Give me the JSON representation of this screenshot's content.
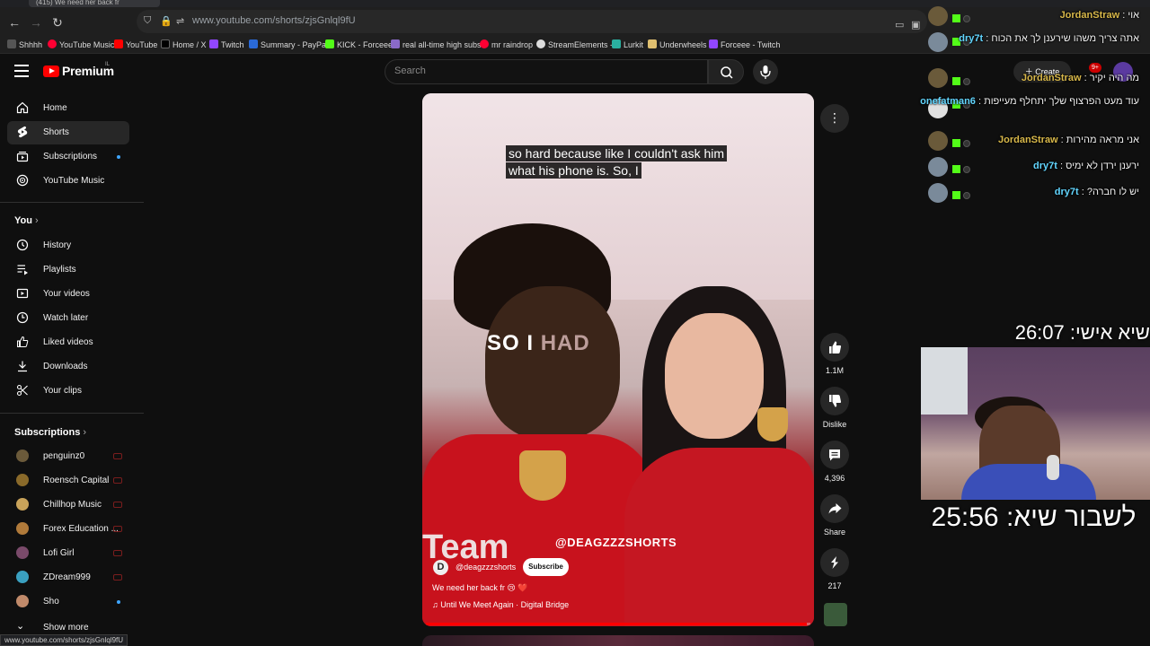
{
  "browser": {
    "active_tab": "(415) We need her back fr",
    "url": "www.youtube.com/shorts/zjsGnlql9fU",
    "bookmarks": [
      "Shhhh",
      "YouTube Music",
      "YouTube",
      "Home / X",
      "Twitch",
      "Summary - PayPal",
      "KICK - Forceee",
      "real all-time high subs",
      "mr raindrop",
      "StreamElements -",
      "Lurkit",
      "Underwheels",
      "Forceee - Twitch"
    ],
    "status_url": "www.youtube.com/shorts/zjsGnlql9fU"
  },
  "header": {
    "logo_text": "Premium",
    "region": "IL",
    "search_placeholder": "Search",
    "create_label": "Create",
    "notif_count": "9+"
  },
  "sidebar": {
    "main": [
      {
        "label": "Home",
        "icon": "home-icon"
      },
      {
        "label": "Shorts",
        "icon": "shorts-icon",
        "active": true
      },
      {
        "label": "Subscriptions",
        "icon": "subscriptions-icon",
        "dot": true
      },
      {
        "label": "YouTube Music",
        "icon": "music-icon"
      }
    ],
    "you_heading": "You",
    "you": [
      {
        "label": "History",
        "icon": "history-icon"
      },
      {
        "label": "Playlists",
        "icon": "playlists-icon"
      },
      {
        "label": "Your videos",
        "icon": "your-videos-icon"
      },
      {
        "label": "Watch later",
        "icon": "clock-icon"
      },
      {
        "label": "Liked videos",
        "icon": "thumbs-up-icon"
      },
      {
        "label": "Downloads",
        "icon": "download-icon"
      },
      {
        "label": "Your clips",
        "icon": "scissors-icon"
      }
    ],
    "subs_heading": "Subscriptions",
    "subscriptions": [
      {
        "label": "penguinz0",
        "live": true,
        "color": "#6b5a3a"
      },
      {
        "label": "Roensch Capital",
        "live": true,
        "color": "#8a6a2a"
      },
      {
        "label": "Chillhop Music",
        "live": true,
        "color": "#c9a35a"
      },
      {
        "label": "Forex Education ...",
        "live": true,
        "color": "#b07a3a"
      },
      {
        "label": "Lofi Girl",
        "live": true,
        "color": "#7a4a6a"
      },
      {
        "label": "ZDream999",
        "live": true,
        "color": "#3aa0c0"
      },
      {
        "label": "Sho",
        "dot": true,
        "color": "#c08a6a"
      }
    ],
    "show_more": "Show more"
  },
  "video": {
    "caption_lines": [
      "so hard because like I couldn't ask him",
      "what his phone is. So, I"
    ],
    "big_caption_bright": "SO I",
    "big_caption_dim": "HAD",
    "jersey_text": "Team",
    "watermark": "@DEAGZZZSHORTS",
    "channel_initial": "D",
    "channel_name": "@deagzzzshorts",
    "subscribe_label": "Subscribe",
    "title": "We need her back fr 😢 ❤️",
    "sound": "Until We Meet Again · Digital Bridge",
    "progress": 0.99
  },
  "actions": {
    "likes": "1.1M",
    "dislike_label": "Dislike",
    "comments": "4,396",
    "share_label": "Share",
    "remix_count": "217"
  },
  "chat": [
    {
      "user": "JordanStraw",
      "text": "אוי",
      "color": "#d8b84a",
      "avatar": "#6a5a3a"
    },
    {
      "user": "dry7t",
      "text": "אתה צריך משהו שירענן לך את הכוח",
      "color": "#62d6ff",
      "avatar": "#7a8a9a"
    },
    {
      "user": "JordanStraw",
      "text": "מה היה יקיר",
      "color": "#d8b84a",
      "avatar": "#6a5a3a"
    },
    {
      "user": "onefatman6",
      "text": "עוד מעט הפרצוף שלך יתחלף מעייפות",
      "color": "#62d6ff",
      "avatar": "#e0e0e0"
    },
    {
      "user": "JordanStraw",
      "text": "אני מראה מהירות",
      "color": "#d8b84a",
      "avatar": "#6a5a3a"
    },
    {
      "user": "dry7t",
      "text": "ירענן ירדן לא ימיס",
      "color": "#62d6ff",
      "avatar": "#7a8a9a"
    },
    {
      "user": "dry7t",
      "text": "יש לו חברה?",
      "color": "#62d6ff",
      "avatar": "#7a8a9a"
    }
  ],
  "overlay": {
    "timer1": "שיא אישי: 26:07",
    "timer2": "לשבור שיא: 25:56"
  },
  "colors": {
    "accent": "#ff0000",
    "active_item": "#272727",
    "chat_user_gold": "#d8b84a",
    "chat_user_blue": "#62d6ff"
  }
}
